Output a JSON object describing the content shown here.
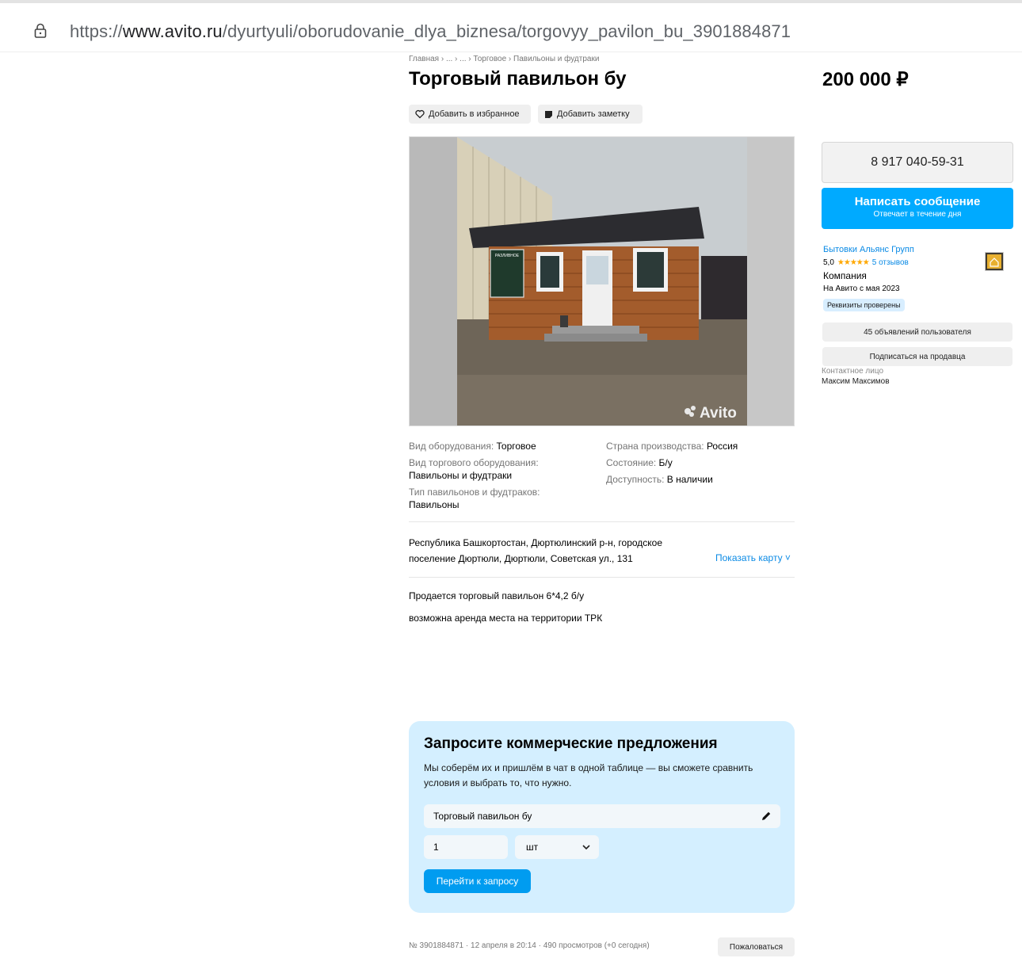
{
  "browser": {
    "url_prefix": "https://",
    "url_host": "www.avito.ru",
    "url_path": "/dyurtyuli/oborudovanie_dlya_biznesa/torgovyy_pavilon_bu_3901884871"
  },
  "listing": {
    "breadcrumb": "Главная › ... › ... › Торговое › Павильоны и фудтраки",
    "title": "Торговый павильон бу",
    "price": "200 000 ₽",
    "favorite_label": "Добавить в избранное",
    "note_label": "Добавить заметку",
    "photo_watermark": "Avito",
    "sign_text": "РАЗЛИВНОЕ"
  },
  "params": {
    "left": [
      {
        "label": "Вид оборудования: ",
        "value": "Торговое"
      },
      {
        "label": "Вид торгового оборудования:",
        "value": "Павильоны и фудтраки"
      },
      {
        "label": "Тип павильонов и фудтраков:",
        "value": "Павильоны"
      }
    ],
    "right": [
      {
        "label": "Страна производства: ",
        "value": "Россия"
      },
      {
        "label": "Состояние: ",
        "value": "Б/у"
      },
      {
        "label": "Доступность: ",
        "value": "В наличии"
      }
    ]
  },
  "location": {
    "address": "Республика Башкортостан, Дюртюлинский р-н, городское поселение Дюртюли, Дюртюли, Советская ул., 131",
    "show_map": "Показать карту ˅"
  },
  "description": {
    "line1": "Продается торговый павильон 6*4,2 б/у",
    "line2": "возможна аренда места на территории ТРК"
  },
  "offer": {
    "title": "Запросите коммерческие предложения",
    "text": "Мы соберём их и пришлём в чат в одной таблице — вы сможете сравнить условия и выбрать то, что нужно.",
    "product": "Торговый павильон бу",
    "quantity": "1",
    "unit": "шт",
    "submit": "Перейти к запросу"
  },
  "footer": {
    "meta": "№ 3901884871 · 12 апреля в 20:14 · 490 просмотров (+0 сегодня)",
    "complain": "Пожаловаться"
  },
  "seller": {
    "phone": "8 917 040-59-31",
    "message_main": "Написать сообщение",
    "message_sub": "Отвечает в течение дня",
    "name": "Бытовки Альянс Групп",
    "score": "5,0",
    "stars": "★★★★★",
    "reviews": "5 отзывов",
    "type": "Компания",
    "since": "На Авито с мая 2023",
    "verified": "Реквизиты проверены",
    "ads_button": "45 объявлений пользователя",
    "subscribe_button": "Подписаться на продавца",
    "contact_label": "Контактное лицо",
    "contact_name": "Максим Максимов"
  },
  "colors": {
    "accent_blue": "#00aaff",
    "link_blue": "#0a8ae5",
    "offer_bg": "#d4efff",
    "star": "#ffa800"
  },
  "icons": {
    "lock": "lock-icon",
    "heart": "heart-icon",
    "note": "note-icon",
    "pencil": "pencil-icon",
    "chevron": "chevron-down-icon"
  }
}
